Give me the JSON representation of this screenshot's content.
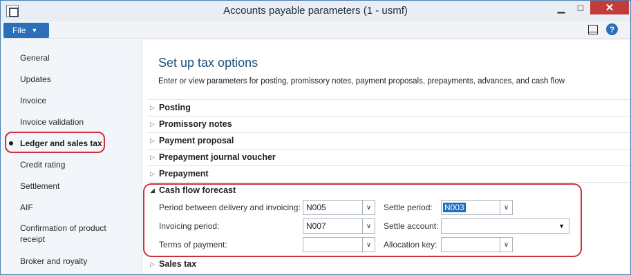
{
  "window": {
    "title": "Accounts payable parameters (1 - usmf)"
  },
  "menu": {
    "file_label": "File"
  },
  "sidebar": {
    "items": [
      {
        "label": "General"
      },
      {
        "label": "Updates"
      },
      {
        "label": "Invoice"
      },
      {
        "label": "Invoice validation"
      },
      {
        "label": "Ledger and sales tax",
        "active": true
      },
      {
        "label": "Credit rating"
      },
      {
        "label": "Settlement"
      },
      {
        "label": "AIF"
      },
      {
        "label": "Confirmation of product receipt"
      },
      {
        "label": "Broker and royalty"
      }
    ]
  },
  "content": {
    "title": "Set up tax options",
    "description": "Enter or view parameters for posting, promissory notes, payment proposals, prepayments, advances, and cash flow",
    "sections": [
      {
        "label": "Posting",
        "expanded": false
      },
      {
        "label": "Promissory notes",
        "expanded": false
      },
      {
        "label": "Payment proposal",
        "expanded": false
      },
      {
        "label": "Prepayment journal voucher",
        "expanded": false
      },
      {
        "label": "Prepayment",
        "expanded": false
      },
      {
        "label": "Cash flow forecast",
        "expanded": true
      },
      {
        "label": "Sales tax",
        "expanded": false
      }
    ]
  },
  "cash_flow": {
    "period_between_label": "Period between delivery and invoicing:",
    "period_between_value": "N005",
    "invoicing_period_label": "Invoicing period:",
    "invoicing_period_value": "N007",
    "terms_of_payment_label": "Terms of payment:",
    "terms_of_payment_value": "",
    "settle_period_label": "Settle period:",
    "settle_period_value": "N003",
    "settle_account_label": "Settle account:",
    "settle_account_value": "",
    "allocation_key_label": "Allocation key:",
    "allocation_key_value": ""
  },
  "colors": {
    "accent": "#2a6fb8",
    "highlight": "#cf2f3d",
    "title": "#1f4f7a"
  }
}
